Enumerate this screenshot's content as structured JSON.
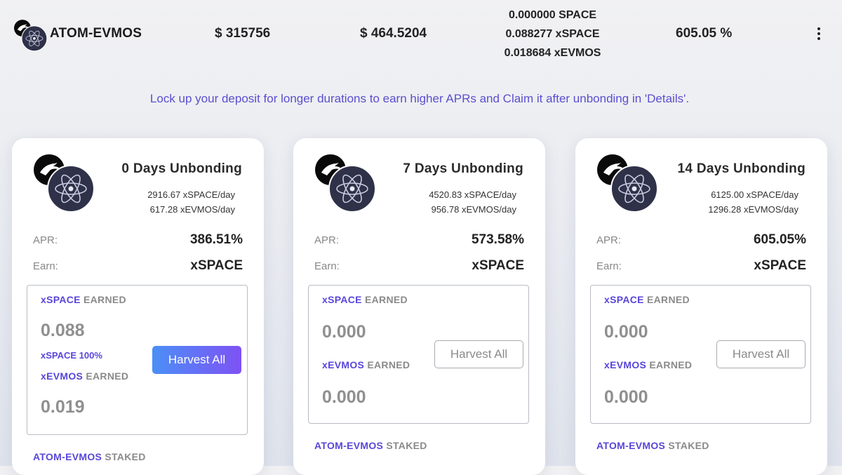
{
  "header": {
    "pair": "ATOM-EVMOS",
    "tvl": "$ 315756",
    "value": "$ 464.5204",
    "rewards": [
      "0.000000 SPACE",
      "0.088277 xSPACE",
      "0.018684 xEVMOS"
    ],
    "apr": "605.05 %",
    "menu_icon": "kebab-menu-icon"
  },
  "notice": "Lock up your deposit for longer durations to earn higher APRs and Claim it after unbonding in 'Details'.",
  "cards": [
    {
      "title": "0 Days Unbonding",
      "rate1": "2916.67 xSPACE/day",
      "rate2": "617.28 xEVMOS/day",
      "apr_label": "APR:",
      "apr": "386.51%",
      "earn_label": "Earn:",
      "earn": "xSPACE",
      "earned_token": "xSPACE",
      "earned_suffix": "EARNED",
      "earned_value": "0.088",
      "share": "xSPACE 100%",
      "earned2_token": "xEVMOS",
      "earned2_suffix": "EARNED",
      "earned2_value": "0.019",
      "harvest": "Harvest All",
      "staked_token": "ATOM-EVMOS",
      "staked_suffix": "STAKED"
    },
    {
      "title": "7 Days Unbonding",
      "rate1": "4520.83 xSPACE/day",
      "rate2": "956.78 xEVMOS/day",
      "apr_label": "APR:",
      "apr": "573.58%",
      "earn_label": "Earn:",
      "earn": "xSPACE",
      "earned_token": "xSPACE",
      "earned_suffix": "EARNED",
      "earned_value": "0.000",
      "earned2_token": "xEVMOS",
      "earned2_suffix": "EARNED",
      "earned2_value": "0.000",
      "harvest": "Harvest All",
      "staked_token": "ATOM-EVMOS",
      "staked_suffix": "STAKED"
    },
    {
      "title": "14 Days Unbonding",
      "rate1": "6125.00 xSPACE/day",
      "rate2": "1296.28 xEVMOS/day",
      "apr_label": "APR:",
      "apr": "605.05%",
      "earn_label": "Earn:",
      "earn": "xSPACE",
      "earned_token": "xSPACE",
      "earned_suffix": "EARNED",
      "earned_value": "0.000",
      "earned2_token": "xEVMOS",
      "earned2_suffix": "EARNED",
      "earned2_value": "0.000",
      "harvest": "Harvest All",
      "staked_token": "ATOM-EVMOS",
      "staked_suffix": "STAKED"
    }
  ],
  "colors": {
    "accent": "#5846d9",
    "notice": "#5a4fcf",
    "button_gradient_start": "#4b8ff6",
    "button_gradient_end": "#7e52f5"
  }
}
